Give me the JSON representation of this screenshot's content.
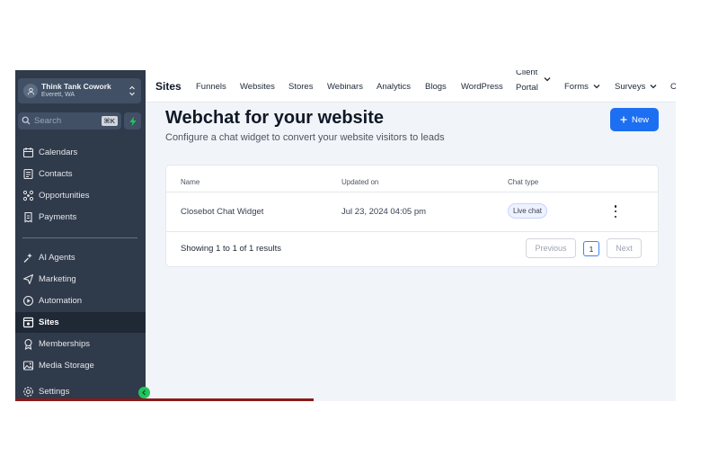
{
  "location": {
    "name": "Think Tank Cowork",
    "subtitle": "Everett, WA"
  },
  "search": {
    "placeholder": "Search",
    "shortcut": "⌘K"
  },
  "sidebar": {
    "items": [
      {
        "label": "Calendars",
        "icon": "calendar-icon"
      },
      {
        "label": "Contacts",
        "icon": "contacts-icon"
      },
      {
        "label": "Opportunities",
        "icon": "opportunities-icon"
      },
      {
        "label": "Payments",
        "icon": "payments-icon"
      },
      {
        "label": "AI Agents",
        "icon": "ai-agents-icon"
      },
      {
        "label": "Marketing",
        "icon": "marketing-icon"
      },
      {
        "label": "Automation",
        "icon": "automation-icon"
      },
      {
        "label": "Sites",
        "icon": "sites-icon",
        "active": true
      },
      {
        "label": "Memberships",
        "icon": "memberships-icon"
      },
      {
        "label": "Media Storage",
        "icon": "media-storage-icon"
      },
      {
        "label": "Settings",
        "icon": "settings-icon"
      }
    ]
  },
  "topnav": {
    "brand": "Sites",
    "items": [
      "Funnels",
      "Websites",
      "Stores",
      "Webinars",
      "Analytics",
      "Blogs",
      "WordPress"
    ],
    "client_portal": [
      "Client",
      "Portal"
    ],
    "forms": "Forms",
    "surveys": "Surveys",
    "overflow": "C"
  },
  "page": {
    "title": "Webchat for your website",
    "subtitle": "Configure a chat widget to convert your website visitors to leads",
    "new_button": "New"
  },
  "table": {
    "columns": [
      "Name",
      "Updated on",
      "Chat type"
    ],
    "rows": [
      {
        "name": "Closebot Chat Widget",
        "updated": "Jul 23, 2024 04:05 pm",
        "chat_type": "Live chat"
      }
    ],
    "summary": "Showing 1 to 1 of 1 results",
    "pagination": {
      "previous": "Previous",
      "page": "1",
      "next": "Next"
    }
  },
  "colors": {
    "sidebar": "#2f3a4b",
    "accent": "#1d6ff2",
    "active_item": "#1f2835",
    "collapse": "#22c55e"
  }
}
